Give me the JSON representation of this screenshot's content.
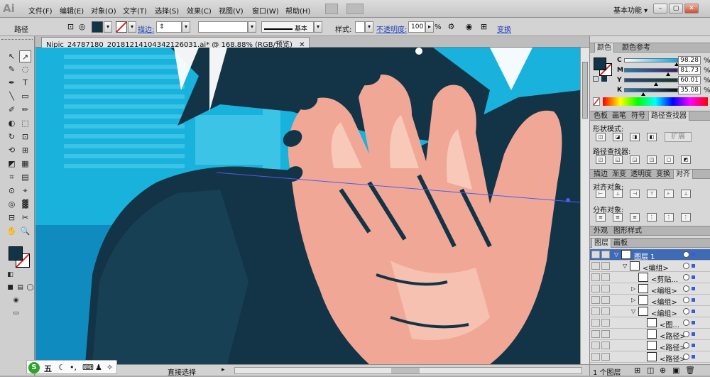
{
  "app": {
    "logo": "Ai",
    "menus": [
      "文件(F)",
      "编辑(E)",
      "对象(O)",
      "文字(T)",
      "选择(S)",
      "效果(C)",
      "视图(V)",
      "窗口(W)",
      "帮助(H)"
    ],
    "workspace_label": "基本功能",
    "window_buttons": [
      "–",
      "▢",
      "✕",
      "–",
      "▢",
      "✕"
    ]
  },
  "control_bar": {
    "selection_type": "路径",
    "stroke_label": "描边:",
    "brush_label": "基本",
    "style_label": "样式:",
    "opacity_label": "不透明度:",
    "opacity_value": "100",
    "opacity_unit": "%",
    "transform_label": "变换",
    "fill_color": "#133446",
    "stroke_color": "#ffffff"
  },
  "document": {
    "tab_title": "Nipic_24787180_20181214104342126031.ai* @ 168.88% (RGB/预览)",
    "tab_close": "✕",
    "status_tool": "直接选择"
  },
  "ime_toolbar": {
    "logo_char": "S",
    "mode_char": "五",
    "icons": [
      "moon-icon",
      "dot-icon",
      "keyboard-icon",
      "shirt-icon",
      "wrench-icon"
    ]
  },
  "toolbox": {
    "tools": [
      "↖",
      "↗",
      "✎",
      "◌",
      "✒",
      "T",
      "╲",
      "▭",
      "✐",
      "✏",
      "◐",
      "⬚",
      "↻",
      "⊡",
      "⟲",
      "⊞",
      "◩",
      "▦",
      "⌗",
      "▤",
      "⊙",
      "⌖",
      "◎",
      "▓",
      "⊟",
      "✂",
      "✋",
      "🔍"
    ],
    "fill_color": "#133446",
    "stroke_color": "#ffffff"
  },
  "color_panel": {
    "tabs": [
      "颜色",
      "颜色参考"
    ],
    "channels": [
      {
        "name": "C",
        "value": "98.28",
        "unit": "%",
        "level": 0.98
      },
      {
        "name": "M",
        "value": "81.73",
        "unit": "%",
        "level": 0.82
      },
      {
        "name": "Y",
        "value": "60.01",
        "unit": "%",
        "level": 0.6
      },
      {
        "name": "K",
        "value": "35.08",
        "unit": "%",
        "level": 0.35
      }
    ]
  },
  "pathfinder_panel": {
    "tabs": [
      "色板",
      "画笔",
      "符号",
      "路径查找器"
    ],
    "shape_modes_label": "形状模式:",
    "expand_label": "扩展",
    "pathfinders_label": "路径查找器:"
  },
  "align_panel": {
    "tabs": [
      "描边",
      "渐变",
      "透明度",
      "变换",
      "对齐"
    ],
    "align_objects_label": "对齐对象:",
    "distribute_label": "分布对象:"
  },
  "appearance_panel": {
    "tabs": [
      "外观",
      "图形样式"
    ]
  },
  "layers_panel": {
    "tabs": [
      "图层",
      "画板"
    ],
    "rows": [
      {
        "label": "图层 1",
        "indent": 0,
        "expander": "▽",
        "is_layer": true
      },
      {
        "label": "<编组>",
        "indent": 1,
        "expander": "▽"
      },
      {
        "label": "<剪贴...",
        "indent": 2,
        "expander": ""
      },
      {
        "label": "<编组>",
        "indent": 2,
        "expander": "▷"
      },
      {
        "label": "<编组>",
        "indent": 2,
        "expander": "▷"
      },
      {
        "label": "<编组>",
        "indent": 2,
        "expander": "▽"
      },
      {
        "label": "<图...",
        "indent": 3,
        "expander": ""
      },
      {
        "label": "<路径>",
        "indent": 3,
        "expander": ""
      },
      {
        "label": "<路径>",
        "indent": 3,
        "expander": ""
      },
      {
        "label": "<路径>",
        "indent": 3,
        "expander": ""
      }
    ],
    "footer_count": "1 个图层"
  }
}
